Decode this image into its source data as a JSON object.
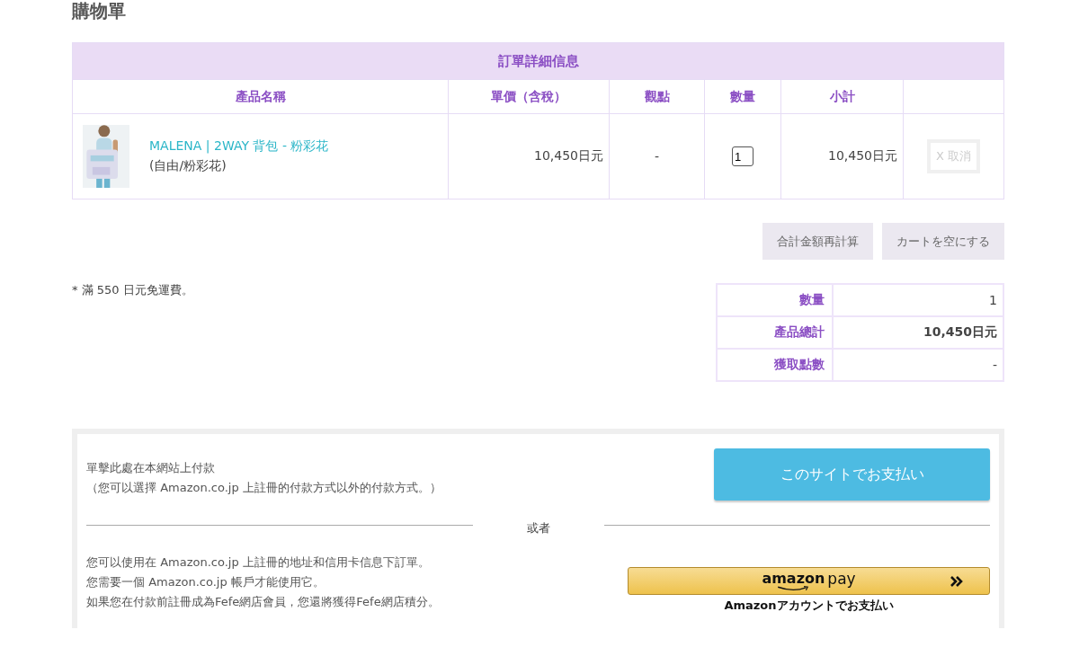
{
  "page_title": "購物單",
  "order_table": {
    "title": "訂單詳細信息",
    "columns": [
      "產品名稱",
      "單價（含稅）",
      "觀點",
      "數量",
      "小計",
      ""
    ],
    "rows": [
      {
        "name": "MALENA | 2WAY 背包 - 粉彩花",
        "variant": "(自由/粉彩花)",
        "price": "10,450日元",
        "points": "-",
        "quantity": "1",
        "subtotal": "10,450日元",
        "cancel": {
          "label": "X 取消",
          "disabled": true
        }
      }
    ]
  },
  "cart_buttons": [
    "合計金額再計算",
    "カートを空にする"
  ],
  "shipping_note": "* 滿 550 日元免運費。",
  "summary": [
    {
      "label": "數量",
      "value": "1",
      "bold": false
    },
    {
      "label": "產品總計",
      "value": "10,450日元",
      "bold": true
    },
    {
      "label": "獲取點數",
      "value": "-",
      "bold": false
    }
  ],
  "payment": {
    "site_text": [
      "單擊此處在本網站上付款",
      "（您可以選擇 Amazon.co.jp 上註冊的付款方式以外的付款方式。）"
    ],
    "site_button": "このサイトでお支払い",
    "divider_text": "或者",
    "amazon_text": [
      "您可以使用在 Amazon.co.jp 上註冊的地址和信用卡信息下訂單。",
      "您需要一個 Amazon.co.jp 帳戶才能使用它。",
      "如果您在付款前註冊成為Fefe網店會員，您還將獲得Fefe網店積分。"
    ],
    "amazon_button": {
      "brand": "amazon",
      "suffix": "pay"
    },
    "amazon_caption": "Amazonアカウントでお支払い"
  }
}
